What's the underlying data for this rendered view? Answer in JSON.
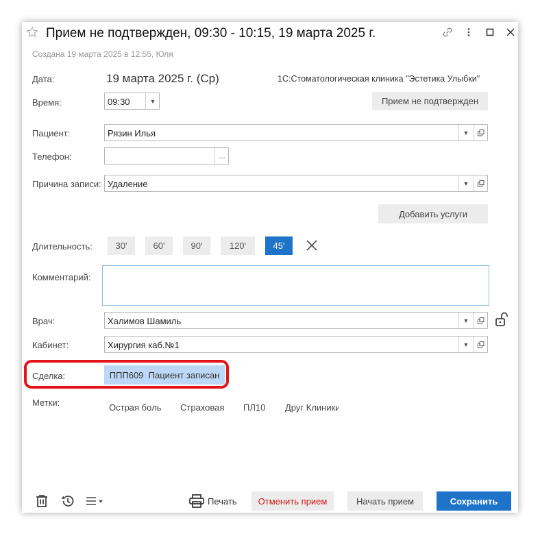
{
  "header": {
    "title": "Прием не подтвержден, 09:30 - 10:15, 19 марта 2025 г.",
    "created": "Создана 19 марта 2025 в 12:55, Юля"
  },
  "form": {
    "date_label": "Дата:",
    "date_value": "19 марта 2025 г. (Ср)",
    "clinic": "1С:Стоматологическая клиника \"Эстетика Улыбки\"",
    "time_label": "Время:",
    "time_value": "09:30",
    "status_button": "Прием не подтвержден",
    "patient_label": "Пациент:",
    "patient_value": "Рязин Илья",
    "phone_label": "Телефон:",
    "phone_value": "",
    "reason_label": "Причина записи:",
    "reason_value": "Удаление",
    "add_services_button": "Добавить услуги",
    "duration_label": "Длительность:",
    "durations": [
      "30'",
      "60'",
      "90'",
      "120'",
      "45'"
    ],
    "comment_label": "Комментарий:",
    "comment_value": "",
    "doctor_label": "Врач:",
    "doctor_value": "Халимов Шамиль",
    "room_label": "Кабинет:",
    "room_value": "Хирургия каб.№1",
    "deal_label": "Сделка:",
    "deal_value": "ППП609  Пациент записан",
    "tags_label": "Метки:",
    "tags": [
      "Острая боль",
      "Страховая",
      "ПЛ10",
      "Друг Клиники"
    ]
  },
  "footer": {
    "print": "Печать",
    "cancel": "Отменить прием",
    "start": "Начать прием",
    "save": "Сохранить"
  },
  "colors": {
    "accent": "#1f74c9",
    "highlight_outline": "#e2141a",
    "deal_bg": "#bcd8f6",
    "cancel_text": "#cc1a1a"
  }
}
